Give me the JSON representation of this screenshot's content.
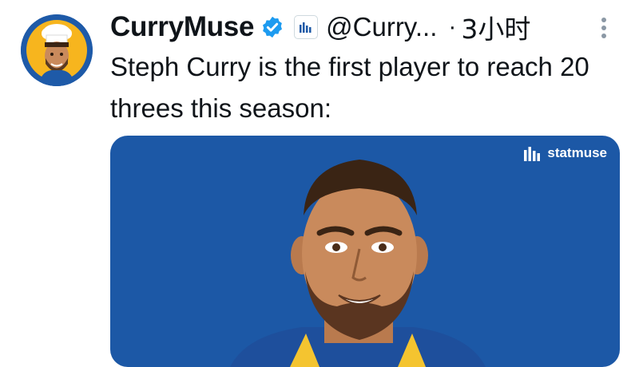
{
  "tweet": {
    "display_name": "CurryMuse",
    "handle": "@Curry...",
    "separator": "·",
    "time": "3小时",
    "text": "Steph Curry is the first player to reach 20 threes this season:"
  },
  "media": {
    "brand": "statmuse"
  },
  "icons": {
    "verified": "verified-badge-icon",
    "affiliate": "statmuse-affiliate-icon",
    "more": "more-options-icon"
  },
  "colors": {
    "media_background": "#1c58a6",
    "verified": "#1d9bf0",
    "text": "#0f1419"
  }
}
